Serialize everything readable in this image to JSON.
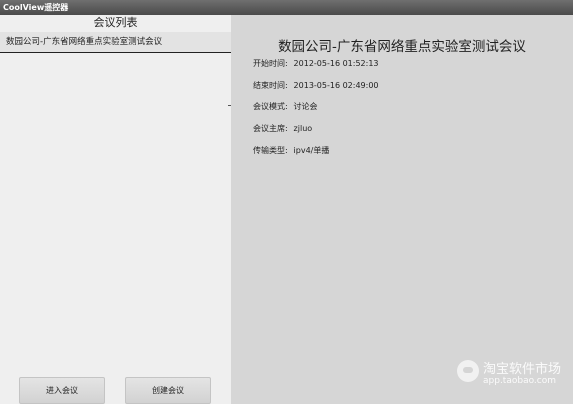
{
  "window": {
    "title": "CoolView遥控器"
  },
  "meeting_list": {
    "header": "会议列表",
    "items": [
      {
        "label": "数园公司-广东省网络重点实验室测试会议"
      }
    ]
  },
  "buttons": {
    "enter": "进入会议",
    "create": "创建会议"
  },
  "detail": {
    "title": "数园公司-广东省网络重点实验室测试会议",
    "fields": [
      {
        "label": "开始时间:",
        "value": "2012-05-16 01:52:13"
      },
      {
        "label": "结束时间:",
        "value": "2013-05-16 02:49:00"
      },
      {
        "label": "会议模式:",
        "value": "讨论会"
      },
      {
        "label": "会议主席:",
        "value": "zjluo"
      },
      {
        "label": "传输类型:",
        "value": "ipv4/单播"
      }
    ]
  },
  "watermark": {
    "name": "淘宝软件市场",
    "url": "app.taobao.com"
  }
}
